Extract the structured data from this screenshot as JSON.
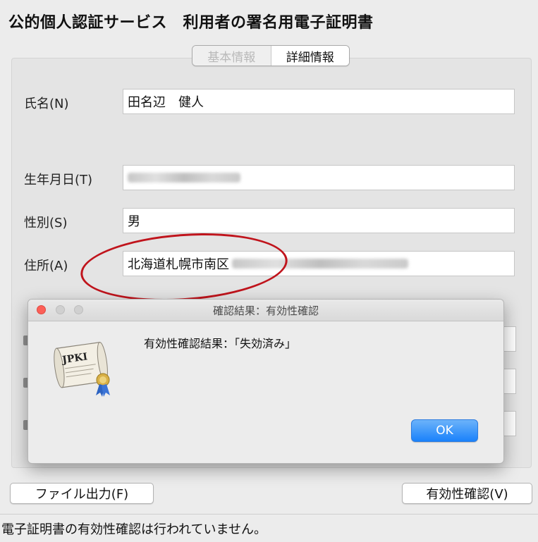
{
  "window": {
    "title": "公的個人認証サービス　利用者の署名用電子証明書"
  },
  "tabs": [
    {
      "label": "基本情報",
      "active": false
    },
    {
      "label": "詳細情報",
      "active": true
    }
  ],
  "fields": {
    "name": {
      "label": "氏名(N)",
      "value": "田名辺　健人"
    },
    "birthdate": {
      "label": "生年月日(T)"
    },
    "gender": {
      "label": "性別(S)",
      "value": "男"
    },
    "address": {
      "label": "住所(A)",
      "value": "北海道札幌市南区"
    }
  },
  "buttons": {
    "file_output": "ファイル出力(F)",
    "validate": "有効性確認(V)"
  },
  "status_bar": {
    "text": "電子証明書の有効性確認は行われていません。"
  },
  "dialog": {
    "title": "確認結果：有効性確認",
    "message": "有効性確認結果：「失効済み」",
    "icon_label": "JPKI",
    "ok_label": "OK"
  },
  "colors": {
    "annotation": "#c0141c",
    "ok_button": "#1a82fb",
    "close_button": "#fc5f57"
  }
}
